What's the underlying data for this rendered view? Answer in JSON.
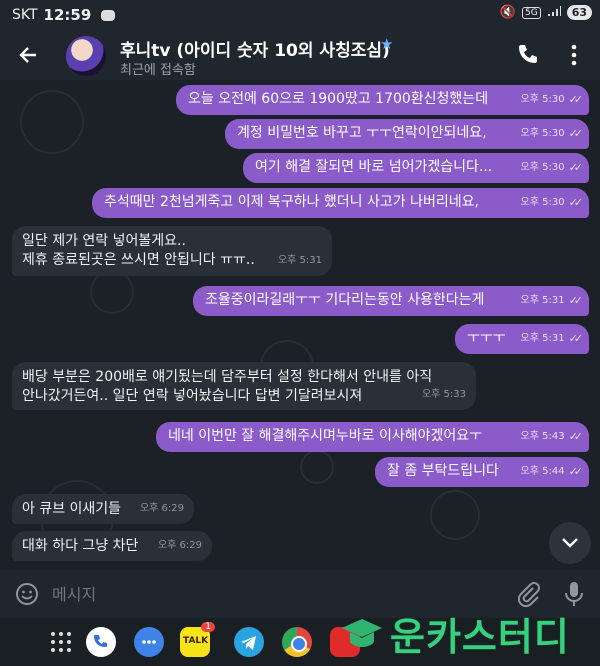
{
  "status_bar": {
    "carrier": "SKT",
    "time": "12:59",
    "network": "5G",
    "battery": "63"
  },
  "header": {
    "title": "후니tv (아이디 숫자 10외 사칭조심)",
    "subtitle": "최근에 접속함"
  },
  "messages": [
    {
      "dir": "out",
      "text": "오늘 오전에 60으로 1900땄고 1700환신청했는데",
      "time": "오후 5:30"
    },
    {
      "dir": "out",
      "text": "계정 비밀번호 바꾸고 ㅜㅜ연락이안되네요,",
      "time": "오후 5:30"
    },
    {
      "dir": "out",
      "text": "여기 해결 잘되면 바로 넘어가겠습니다...",
      "time": "오후 5:30"
    },
    {
      "dir": "out",
      "text": "추석때만 2천넘게죽고 이제 복구하나 했더니 사고가 나버리네요,",
      "time": "오후 5:30"
    },
    {
      "dir": "in",
      "lines": [
        "일단 제가 연락 넣어볼게요..",
        "제휴 종료된곳은 쓰시면 안됩니다 ㅠㅠ.."
      ],
      "time": "오후 5:31"
    },
    {
      "dir": "out",
      "text": "조율중이라길래ㅜㅜ 기다리는동안 사용한다는게",
      "time": "오후 5:31"
    },
    {
      "dir": "out",
      "text": "ㅜㅜㅜ",
      "time": "오후 5:31"
    },
    {
      "dir": "in",
      "lines": [
        "배당 부분은 200배로 얘기됬는데 담주부터 설정 한다해서 안내를 아직",
        "안나갔거든여.. 일단 연락 넣어놨습니다 답변 기달려보시져"
      ],
      "time": "오후 5:33"
    },
    {
      "dir": "out",
      "text": "네네 이번만 잘 해결해주시며누바로 이사해야겠어요ㅜ",
      "time": "오후 5:43"
    },
    {
      "dir": "out",
      "text": "잘 좀 부탁드립니다",
      "time": "오후 5:44"
    },
    {
      "dir": "in",
      "text": "아 큐브 이새기들",
      "time": "오후 6:29"
    },
    {
      "dir": "in",
      "text": "대화 하다 그냥 차단",
      "time": "오후 6:29"
    }
  ],
  "input": {
    "placeholder": "메시지"
  },
  "dock": {
    "kakao_badge": "1",
    "kakao_label": "TALK"
  },
  "watermark": {
    "text": "운카스터디"
  },
  "colors": {
    "outgoing_bubble": "#8b5bc9",
    "incoming_bubble": "#2a3037",
    "background": "#1b2126",
    "header": "#20262d"
  }
}
